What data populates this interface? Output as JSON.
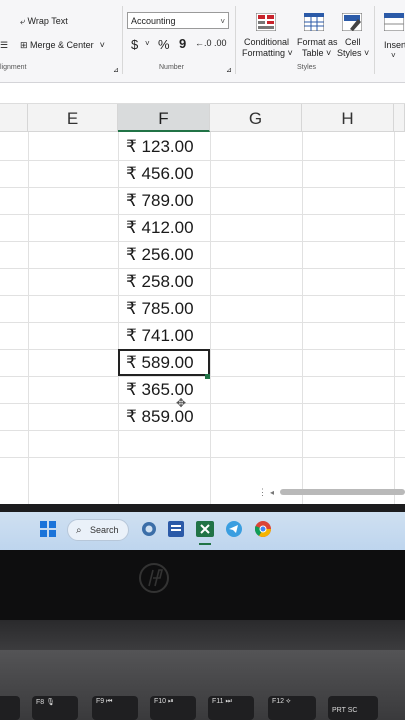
{
  "ribbon": {
    "wrap_text": "Wrap Text",
    "merge_center": "Merge & Center",
    "alignment_group": "lignment",
    "number_format": "Accounting",
    "currency_symbol": "$",
    "currency_caret": "˅",
    "percent_symbol": "%",
    "comma_symbol": "9",
    "number_group": "Number",
    "conditional_formatting": [
      "Conditional",
      "Formatting ˅"
    ],
    "format_as_table": [
      "Format as",
      "Table ˅"
    ],
    "cell_styles": [
      "Cell",
      "Styles ˅"
    ],
    "styles_group": "Styles",
    "insert": "Insert"
  },
  "columns": [
    "E",
    "F",
    "G",
    "H"
  ],
  "selected_column": "F",
  "cells": [
    "₹ 123.00",
    "₹ 456.00",
    "₹ 789.00",
    "₹ 412.00",
    "₹ 256.00",
    "₹ 258.00",
    "₹ 785.00",
    "₹ 741.00",
    "₹ 589.00",
    "₹ 365.00",
    "₹ 859.00"
  ],
  "active_cell_index": 8,
  "taskbar": {
    "search_label": "Search"
  },
  "keyboard": {
    "keys": [
      "F8",
      "F9",
      "F10",
      "F11",
      "F12",
      "PRT SC"
    ]
  },
  "colors": {
    "accent": "#217346",
    "taskbar": "#c4d9f0"
  }
}
